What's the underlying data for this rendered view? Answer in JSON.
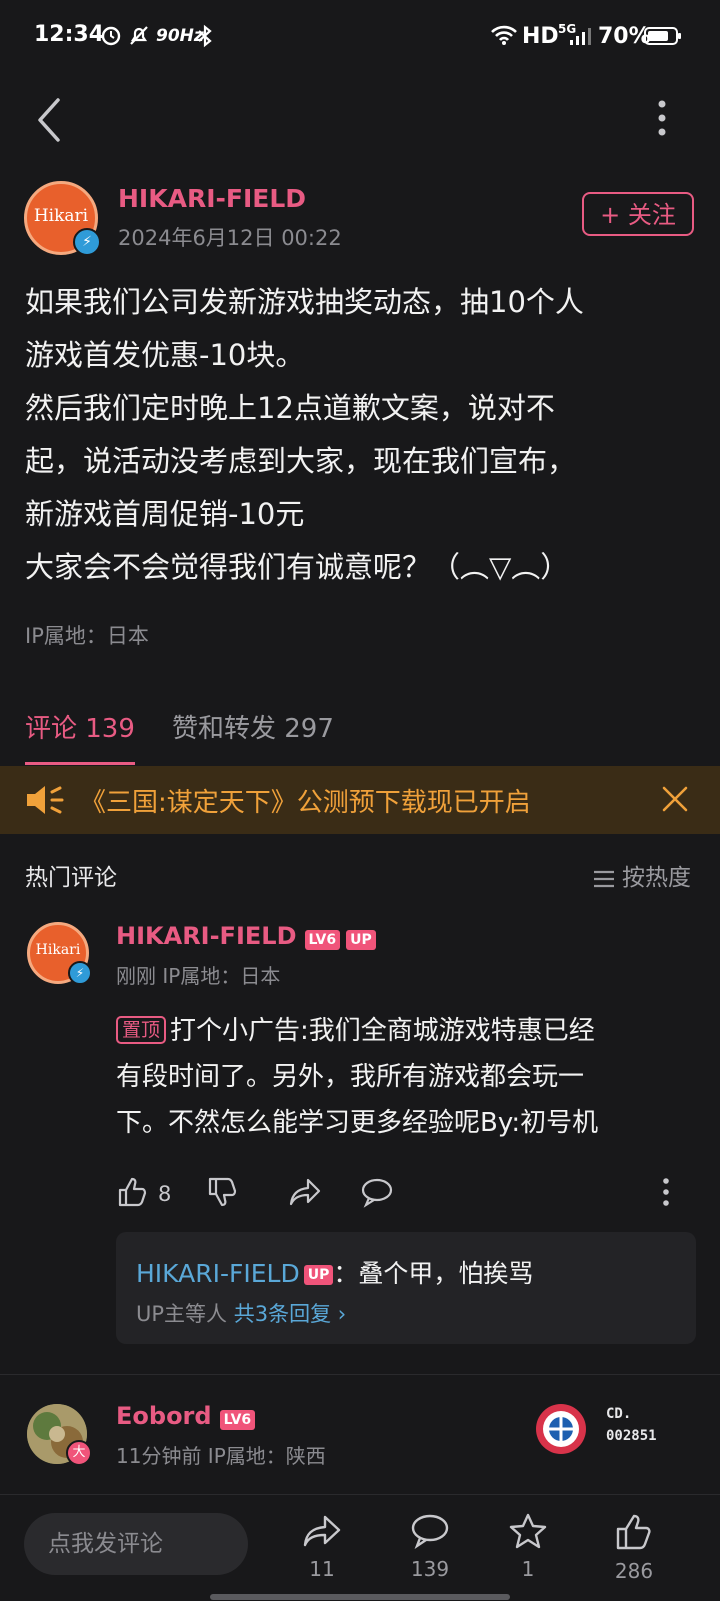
{
  "status_bar": {
    "time": "12:34",
    "refresh_rate": "90Hz",
    "hd": "HD",
    "network": "5G",
    "battery": "70%"
  },
  "post": {
    "author": "HIKARI-FIELD",
    "avatar_text": "Hikari",
    "date": "2024年6月12日 00:22",
    "follow_label": "+ 关注",
    "body_lines": [
      "如果我们公司发新游戏抽奖动态，抽10个人",
      "游戏首发优惠-10块。",
      "然后我们定时晚上12点道歉文案，说对不",
      "起，说活动没考虑到大家，现在我们宣布，",
      "新游戏首周促销-10元",
      "大家会不会觉得我们有诚意呢？（︵▽︵）"
    ],
    "ip": "IP属地：日本"
  },
  "tabs": {
    "comments": "评论 139",
    "likes_forwards": "赞和转发 297"
  },
  "notice": {
    "text": "《三国:谋定天下》公测预下载现已开启"
  },
  "comments_section": {
    "title": "热门评论",
    "sort_label": "按热度"
  },
  "comment1": {
    "author": "HIKARI-FIELD",
    "level": "LV6",
    "up_badge": "UP",
    "meta": "刚刚  IP属地：日本",
    "pin": "置顶",
    "text_lines": [
      "打个小广告:我们全商城游戏特惠已经",
      "有段时间了。另外，我所有游戏都会玩一",
      "下。不然怎么能学习更多经验呢By:初号机"
    ],
    "likes": "8",
    "reply": {
      "name": "HIKARI-FIELD",
      "up_badge": "UP",
      "text": "：叠个甲，怕挨骂",
      "summary_prefix": "UP主等人",
      "summary_link": "共3条回复 ›"
    }
  },
  "comment2": {
    "author": "Eobord",
    "level": "LV6",
    "meta": "11分钟前  IP属地：陕西",
    "badge_small": "大",
    "fan_card_line1": "CD.",
    "fan_card_line2": "002851"
  },
  "bottom_bar": {
    "input_placeholder": "点我发评论",
    "forward_count": "11",
    "comment_count": "139",
    "star_count": "1",
    "like_count": "286"
  },
  "colors": {
    "accent_pink": "#e85b83",
    "link_blue": "#5aa8d8",
    "notice_orange": "#f0a13a",
    "background": "#18181a"
  }
}
